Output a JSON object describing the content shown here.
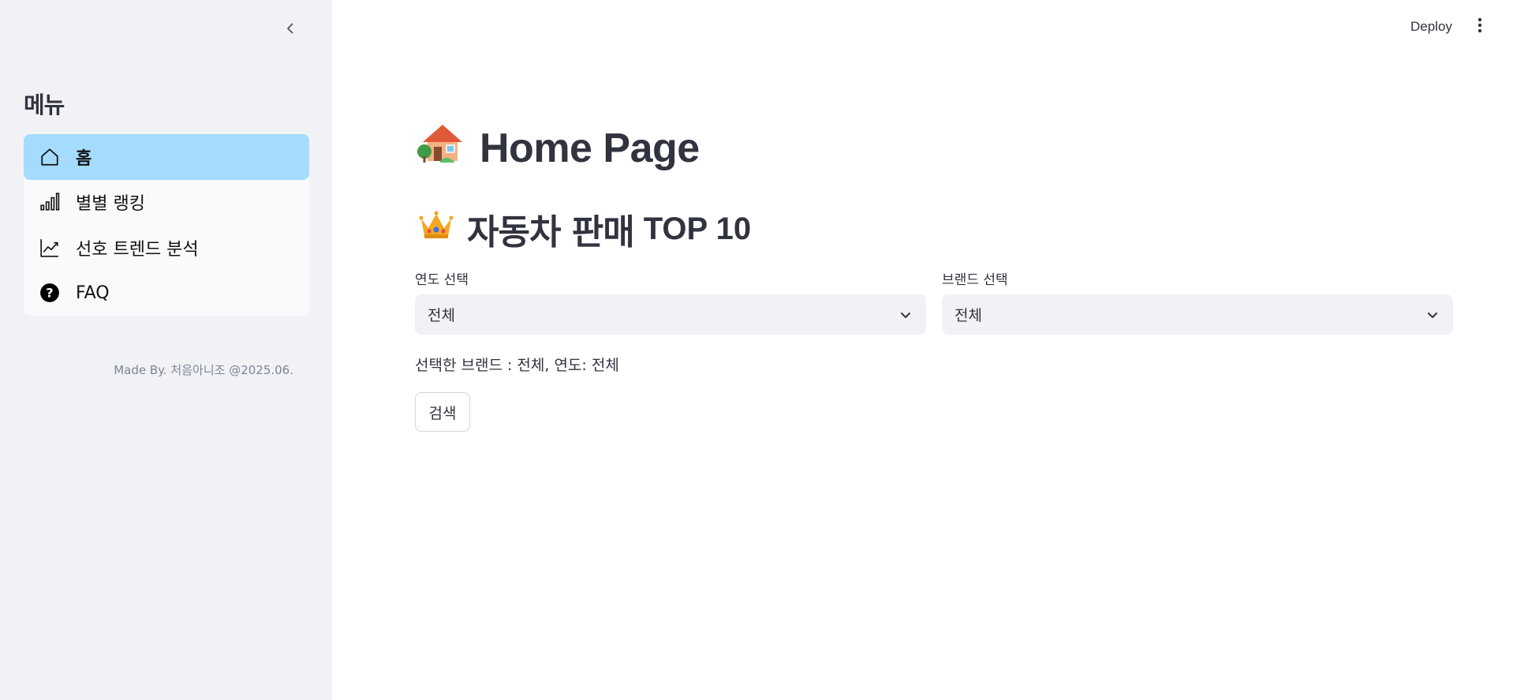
{
  "sidebar": {
    "title": "메뉴",
    "collapse_icon": "chevron-left-icon",
    "items": [
      {
        "label": "홈",
        "icon": "home-icon",
        "active": true
      },
      {
        "label": "별별 랭킹",
        "icon": "bar-chart-icon",
        "active": false
      },
      {
        "label": "선호 트렌드 분석",
        "icon": "trend-chart-icon",
        "active": false
      },
      {
        "label": "FAQ",
        "icon": "question-circle-icon",
        "active": false
      }
    ],
    "footer": "Made By. 처음아니조 @2025.06."
  },
  "header": {
    "deploy_label": "Deploy",
    "menu_icon": "kebab-menu-icon"
  },
  "main": {
    "title": "Home Page",
    "title_icon": "house-emoji-icon",
    "subtitle": "자동차 판매",
    "subtitle_suffix": "TOP 10",
    "subtitle_icon": "crown-emoji-icon",
    "year_select": {
      "label": "연도 선택",
      "value": "전체"
    },
    "brand_select": {
      "label": "브랜드 선택",
      "value": "전체"
    },
    "selection_text": "선택한 브랜드 : 전체, 연도: 전체",
    "search_label": "검색"
  },
  "colors": {
    "sidebar_bg": "#f0f2f6",
    "active_item_bg": "#a5dcfd",
    "text": "#31333f",
    "muted": "#808495"
  }
}
